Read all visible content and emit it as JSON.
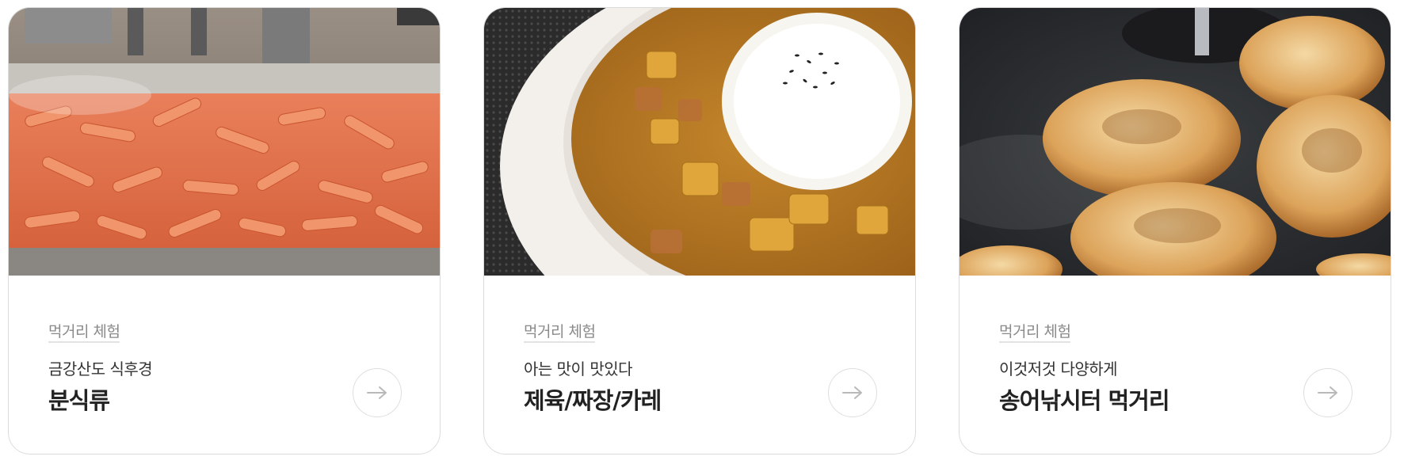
{
  "cards": [
    {
      "tag": "먹거리 체험",
      "subtitle": "금강산도 식후경",
      "title": "분식류",
      "image_icon": "tteokbokki-photo",
      "arrow_icon": "arrow-right-icon"
    },
    {
      "tag": "먹거리 체험",
      "subtitle": "아는 맛이 맛있다",
      "title": "제육/짜장/카레",
      "image_icon": "curry-rice-photo",
      "arrow_icon": "arrow-right-icon"
    },
    {
      "tag": "먹거리 체험",
      "subtitle": "이것저것 다양하게",
      "title": "송어낚시터 먹거리",
      "image_icon": "hotteok-photo",
      "arrow_icon": "arrow-right-icon"
    }
  ],
  "colors": {
    "border": "#dcdcdc",
    "tag_text": "#8a8a8a",
    "title_text": "#222222",
    "subtitle_text": "#333333"
  }
}
